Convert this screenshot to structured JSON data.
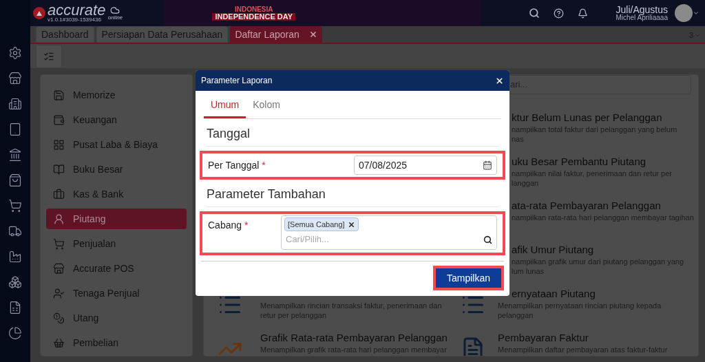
{
  "header": {
    "logo": "accurate",
    "logo_sub": "online",
    "version": "v1.0.1#3039-1539436",
    "banner_line1": "INDONESIA",
    "banner_line2": "INDEPENDENCE DAY",
    "user_name": "Juli/Agustus",
    "user_sub": "Michel Apriliaaaa"
  },
  "tabs": [
    {
      "label": "Dashboard",
      "selected": false,
      "closable": false
    },
    {
      "label": "Persiapan Data Perusahaan",
      "selected": false,
      "closable": false
    },
    {
      "label": "Daftar Laporan",
      "selected": true,
      "closable": true
    }
  ],
  "tab_count": "3",
  "menu": [
    {
      "label": "Memorize",
      "selected": false
    },
    {
      "label": "Keuangan",
      "selected": false
    },
    {
      "label": "Pusat Laba & Biaya",
      "selected": false
    },
    {
      "label": "Buku Besar",
      "selected": false
    },
    {
      "label": "Kas & Bank",
      "selected": false
    },
    {
      "label": "Piutang",
      "selected": true
    },
    {
      "label": "Penjualan",
      "selected": false
    },
    {
      "label": "Accurate POS",
      "selected": false
    },
    {
      "label": "Tenaga Penjual",
      "selected": false
    },
    {
      "label": "Utang",
      "selected": false
    },
    {
      "label": "Pembelian",
      "selected": false
    }
  ],
  "reports": {
    "search_placeholder": "ari...",
    "left": [
      {
        "kind": "list",
        "description": [
          "Menampilkan rincian transaksi faktur, penerimaan dan",
          "retur per pelanggan"
        ]
      },
      {
        "kind": "chart",
        "title": "Grafik Rata-rata Pembayaran Pelanggan",
        "description": [
          "Menampilkan grafik rata-rata hari pelanggan membayar"
        ]
      }
    ],
    "right": [
      {
        "kind": "covered",
        "title": "ktur Belum Lunas per Pelanggan",
        "description": [
          "nampilkan total faktur dari pelanggan yang belum",
          "nas"
        ]
      },
      {
        "kind": "covered",
        "title": "uku Besar Pembantu Piutang",
        "description": [
          "nampilkan nilai faktur, penerimaan dan retur per",
          "langgan"
        ]
      },
      {
        "kind": "covered",
        "title": "ata-rata Pembayaran Pelanggan",
        "description": [
          "nampilkan rata-rata hari pelanggan membayar tagihan"
        ]
      },
      {
        "kind": "covered",
        "title": "afik Umur Piutang",
        "description": [
          "nampilkan grafik umur dari piutang pelanggan yang",
          "lum lunas"
        ]
      },
      {
        "kind": "partlist",
        "title": "ernyataan Piutang",
        "description": [
          "Menampilkan pernyataan rincian piutang kepada",
          "pelanggan"
        ]
      },
      {
        "kind": "doc",
        "title": "Pembayaran Faktur",
        "description": [
          "Menampilkan daftar pembayaran atas faktur-faktur"
        ]
      }
    ]
  },
  "dialog": {
    "title": "Parameter Laporan",
    "tabs": [
      {
        "label": "Umum",
        "selected": true
      },
      {
        "label": "Kolom",
        "selected": false
      }
    ],
    "sections": [
      {
        "heading": "Tanggal",
        "fields": [
          {
            "kind": "date",
            "label": "Per Tanggal",
            "mark": "*",
            "value": "07/08/2025",
            "highlighted": true
          }
        ]
      },
      {
        "heading": "Parameter Tambahan",
        "fields": [
          {
            "kind": "multiselect",
            "label": "Cabang",
            "mark": "*",
            "chips": [
              "[Semua Cabang]"
            ],
            "placeholder": "Cari/Pilih...",
            "highlighted": true
          }
        ]
      }
    ],
    "button": {
      "label": "Tampilkan",
      "highlighted": true
    }
  }
}
